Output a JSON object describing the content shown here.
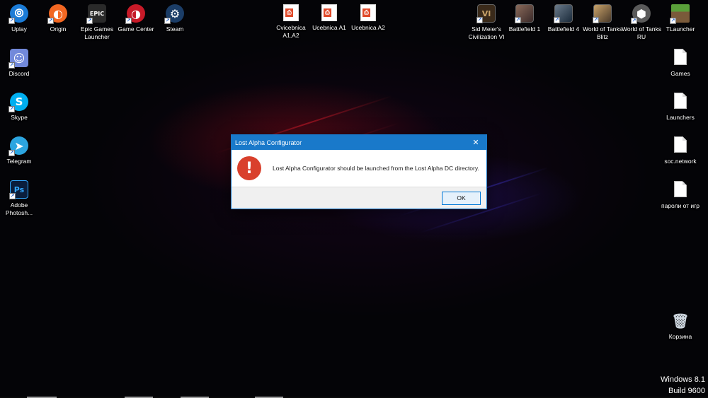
{
  "desktop": {
    "icons_top": [
      {
        "label": "Uplay",
        "icon": "uplay-icon",
        "color": "#1b7bd6"
      },
      {
        "label": "Origin",
        "icon": "origin-icon",
        "color": "#f26722"
      },
      {
        "label": "Epic Games Launcher",
        "icon": "epic-games-icon",
        "color": "#2a2a2a"
      },
      {
        "label": "Game Center",
        "icon": "game-center-icon",
        "color": "#c71a28"
      },
      {
        "label": "Steam",
        "icon": "steam-icon",
        "color": "#1b3d67"
      },
      {
        "label": "Cvicebnica A1,A2",
        "icon": "document-icon",
        "color": "#e04a2a"
      },
      {
        "label": "Ucebnica A1",
        "icon": "document-icon",
        "color": "#e04a2a"
      },
      {
        "label": "Ucebnica A2",
        "icon": "document-icon",
        "color": "#e04a2a"
      },
      {
        "label": "Sid Meier's Civilization VI",
        "icon": "civilization-icon",
        "color": "#3a2a1a"
      },
      {
        "label": "Battlefield 1",
        "icon": "battlefield-1-icon",
        "color": "#6a4a3a"
      },
      {
        "label": "Battlefield 4",
        "icon": "battlefield-4-icon",
        "color": "#3a4a5a"
      },
      {
        "label": "World of Tanks Blitz",
        "icon": "wot-blitz-icon",
        "color": "#8a6a3a"
      },
      {
        "label": "World of Tanks RU",
        "icon": "wot-ru-icon",
        "color": "#5a5a5a"
      },
      {
        "label": "TLauncher",
        "icon": "tlauncher-icon",
        "color": "#4a8a3a"
      }
    ],
    "icons_left": [
      {
        "label": "Discord",
        "icon": "discord-icon",
        "color": "#7289da"
      },
      {
        "label": "Skype",
        "icon": "skype-icon",
        "color": "#00aff0"
      },
      {
        "label": "Telegram",
        "icon": "telegram-icon",
        "color": "#2ca5e0"
      },
      {
        "label": "Adobe Photosh...",
        "icon": "photoshop-icon",
        "color": "#0a1e3c"
      }
    ],
    "icons_right": [
      {
        "label": "Games",
        "icon": "file-icon"
      },
      {
        "label": "Launchers",
        "icon": "file-icon"
      },
      {
        "label": "soc.network",
        "icon": "file-icon"
      },
      {
        "label": "пароли от игр",
        "icon": "file-icon"
      }
    ],
    "recycle_bin": {
      "label": "Корзина",
      "icon": "recycle-bin-icon"
    }
  },
  "dialog": {
    "title": "Lost Alpha Configurator",
    "message": "Lost Alpha Configurator should be launched from the Lost Alpha DC directory.",
    "ok_label": "OK",
    "close_glyph": "✕",
    "accent": "#1979ca",
    "error_color": "#d9402c"
  },
  "watermark": {
    "line1": "Windows 8.1",
    "line2": "Build 9600"
  }
}
